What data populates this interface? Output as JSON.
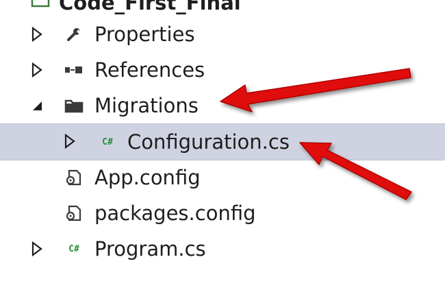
{
  "tree": {
    "project_label": "Code_First_Final",
    "items": [
      {
        "label": "Properties",
        "icon": "wrench-icon"
      },
      {
        "label": "References",
        "icon": "references-icon"
      },
      {
        "label": "Migrations",
        "icon": "folder-icon"
      },
      {
        "label": "Configuration.cs",
        "icon": "csharp-file-icon",
        "badge": "C#"
      },
      {
        "label": "App.config",
        "icon": "config-file-icon"
      },
      {
        "label": "packages.config",
        "icon": "config-file-icon"
      },
      {
        "label": "Program.cs",
        "icon": "csharp-file-icon",
        "badge": "C#"
      }
    ],
    "selected_item": "Configuration.cs"
  },
  "colors": {
    "selection": "#cfd3e1",
    "arrow": "#e01010",
    "csharp_badge": "#2e8b3e"
  }
}
